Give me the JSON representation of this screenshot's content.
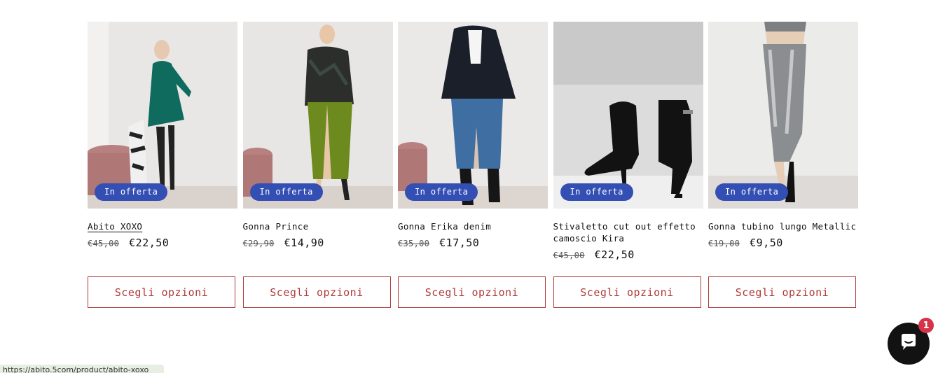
{
  "products": [
    {
      "title": "Abito XOXO",
      "badge": "In offerta",
      "old_price": "€45,00",
      "price": "€22,50",
      "button": "Scegli opzioni",
      "image": "woman-green-sequin-dress-photo"
    },
    {
      "title": "Gonna Prince",
      "badge": "In offerta",
      "old_price": "€29,90",
      "price": "€14,90",
      "button": "Scegli opzioni",
      "image": "woman-green-sequin-skirt-photo"
    },
    {
      "title": "Gonna Erika denim",
      "badge": "In offerta",
      "old_price": "€35,00",
      "price": "€17,50",
      "button": "Scegli opzioni",
      "image": "woman-denim-skirt-photo"
    },
    {
      "title": "Stivaletto cut out effetto camoscio Kira",
      "badge": "In offerta",
      "old_price": "€45,00",
      "price": "€22,50",
      "button": "Scegli opzioni",
      "image": "black-ankle-boots-photo"
    },
    {
      "title": "Gonna tubino lungo Metallic",
      "badge": "In offerta",
      "old_price": "€19,00",
      "price": "€9,50",
      "button": "Scegli opzioni",
      "image": "woman-metallic-skirt-photo"
    }
  ],
  "chat": {
    "unread_count": "1",
    "icon": "chat-bubble-icon"
  },
  "status_bar": {
    "url": "https://abito.5com/product/abito-xoxo"
  },
  "colors": {
    "badge": "#334fb4",
    "button_accent": "#b03a3a",
    "chat_bg": "#121212",
    "chat_badge": "#d6334a"
  }
}
